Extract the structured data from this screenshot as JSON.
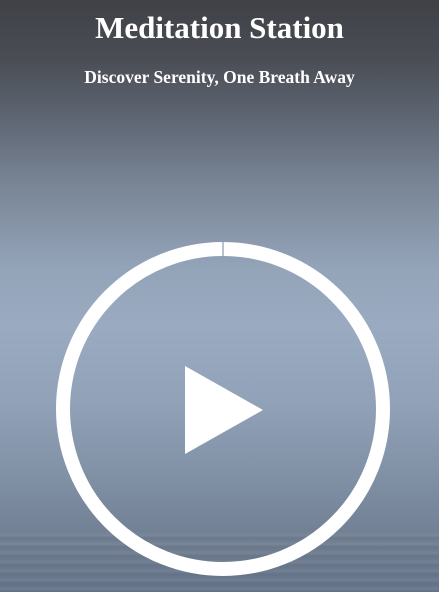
{
  "header": {
    "title": "Meditation Station",
    "subtitle": "Discover Serenity, One Breath Away"
  },
  "player": {
    "icon": "play-icon",
    "progress": 0.0,
    "ring_color": "#ffffff",
    "track_color": "#b8c3d1"
  }
}
